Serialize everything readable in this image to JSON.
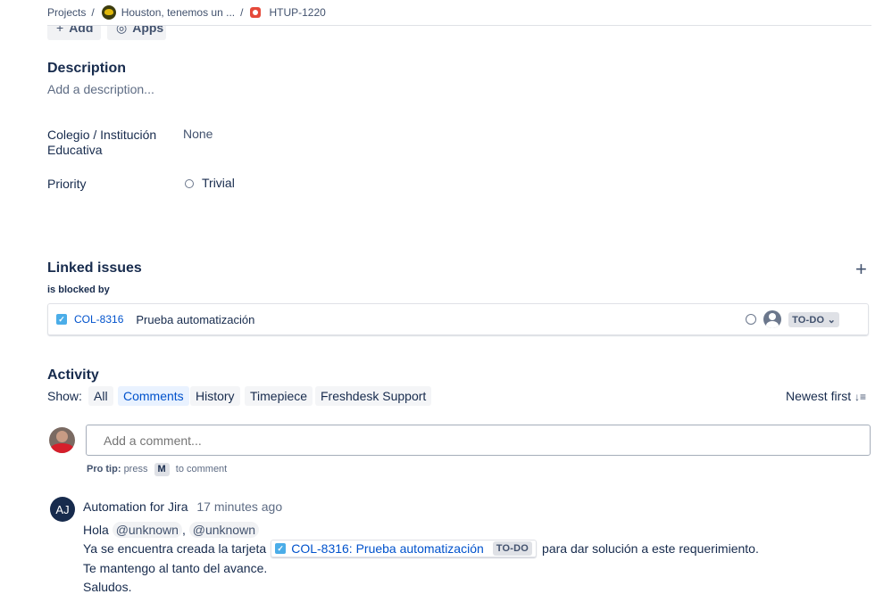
{
  "breadcrumb": {
    "projects": "Projects",
    "project": "Houston, tenemos un ...",
    "issue": "HTUP-1220"
  },
  "toolbar": {
    "add_label": "Add",
    "apps_label": "Apps"
  },
  "description": {
    "title": "Description",
    "placeholder": "Add a description..."
  },
  "fields": {
    "school": {
      "label_line1": "Colegio / Institución",
      "label_line2": "Educativa",
      "value": "None"
    },
    "priority": {
      "label": "Priority",
      "value": "Trivial"
    }
  },
  "linked": {
    "title": "Linked issues",
    "relation": "is blocked by",
    "items": [
      {
        "key": "COL-8316",
        "summary": "Prueba automatización",
        "status": "TO-DO"
      }
    ]
  },
  "activity": {
    "title": "Activity",
    "show_label": "Show:",
    "tabs": [
      "All",
      "Comments",
      "History",
      "Timepiece",
      "Freshdesk Support"
    ],
    "active_tab": "Comments",
    "sort_label": "Newest first",
    "comment_placeholder": "Add a comment...",
    "protip": {
      "bold": "Pro tip:",
      "press": "press",
      "key": "M",
      "suffix": "to comment"
    }
  },
  "comment": {
    "avatar_initials": "AJ",
    "author": "Automation for Jira",
    "time": "17 minutes ago",
    "greeting": "Hola",
    "mention1": "@unknown",
    "comma": ",",
    "mention2": "@unknown",
    "line2_prefix": "Ya se encuentra creada la tarjeta",
    "card_title": "COL-8316: Prueba automatización",
    "card_status": "TO-DO",
    "line2_suffix": "para dar solución a este requerimiento.",
    "line3": "Te mantengo al tanto del avance.",
    "line4": "Saludos."
  },
  "colors": {
    "accent": "#0052cc",
    "text": "#172b4d",
    "subtle": "#5e6c84",
    "story_check": "#4bade8",
    "bug": "#e5493a"
  }
}
